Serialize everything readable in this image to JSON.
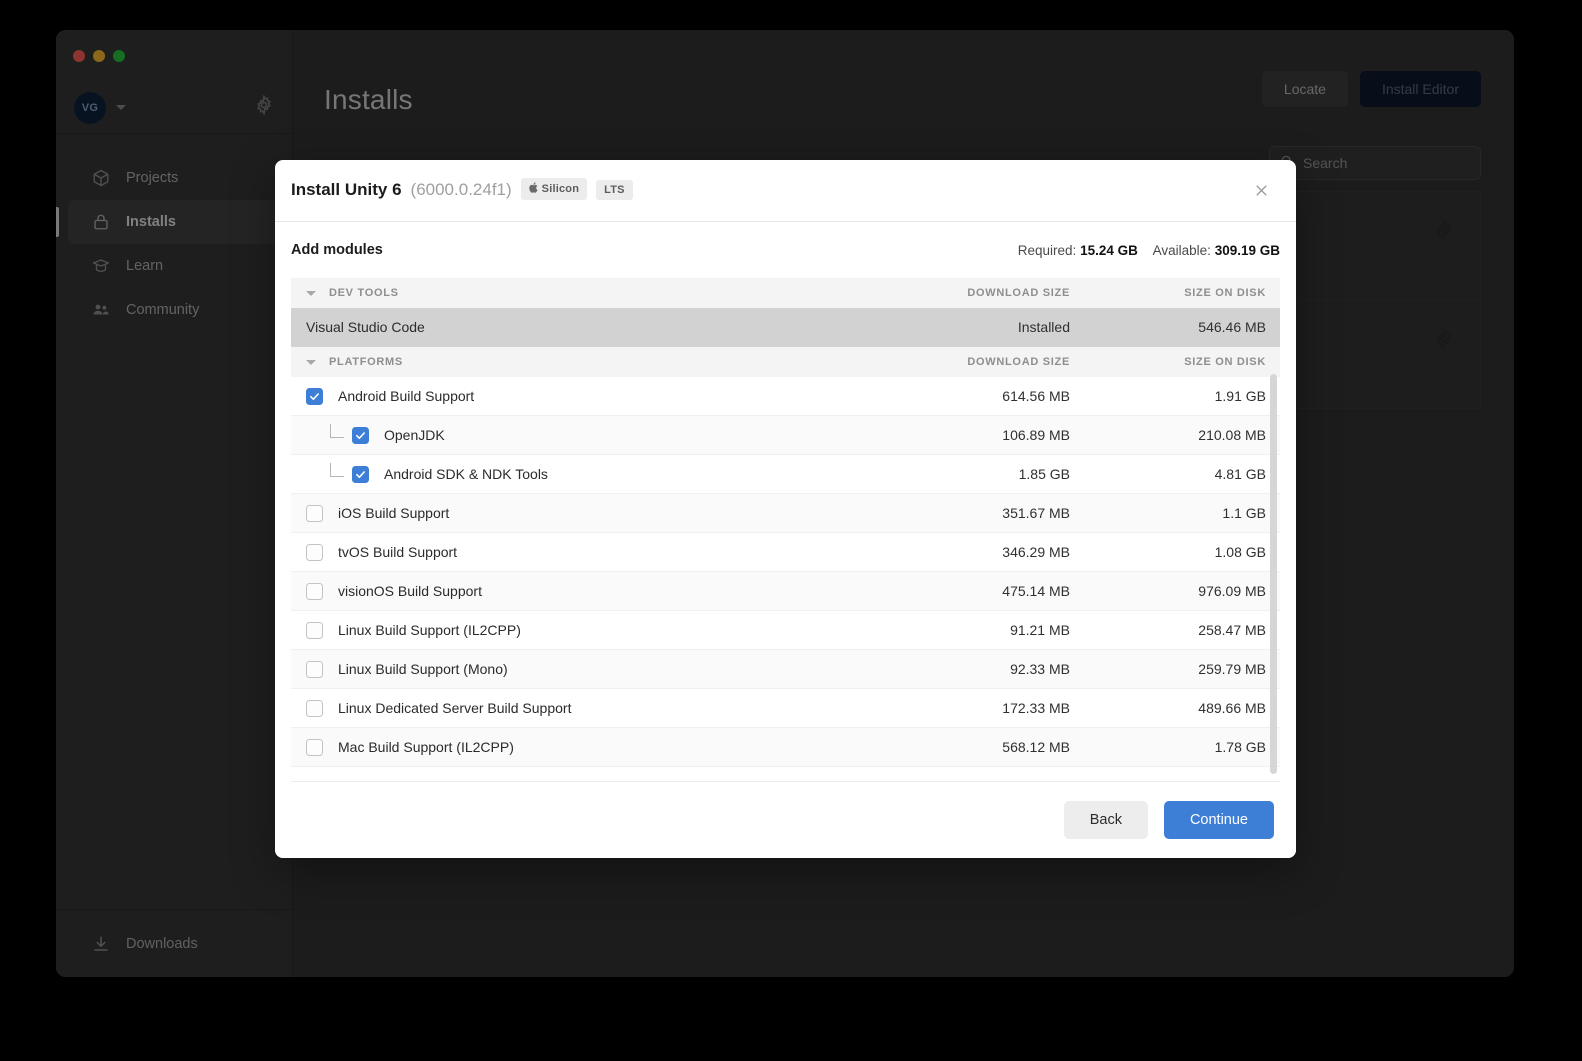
{
  "window": {
    "traffic_lights": [
      "close",
      "minimize",
      "maximize"
    ]
  },
  "sidebar": {
    "account": {
      "initials": "VG"
    },
    "items": [
      {
        "label": "Projects",
        "icon": "cube-icon",
        "active": false
      },
      {
        "label": "Installs",
        "icon": "lock-icon",
        "active": true
      },
      {
        "label": "Learn",
        "icon": "graduation-cap-icon",
        "active": false
      },
      {
        "label": "Community",
        "icon": "people-icon",
        "active": false
      }
    ],
    "downloads": {
      "label": "Downloads",
      "icon": "download-icon"
    }
  },
  "main": {
    "title": "Installs",
    "locate_label": "Locate",
    "install_editor_label": "Install Editor",
    "search_placeholder": "Search",
    "search_value": "",
    "install_cards": [
      {
        "gear": "gear-icon"
      },
      {
        "gear": "gear-icon"
      }
    ]
  },
  "modal": {
    "title": "Install Unity 6",
    "version": "(6000.0.24f1)",
    "chips": [
      {
        "label": "Silicon",
        "icon": "apple-icon"
      },
      {
        "label": "LTS",
        "icon": ""
      }
    ],
    "close_icon": "close-icon",
    "section_label": "Add modules",
    "required_label": "Required:",
    "required_value": "15.24 GB",
    "available_label": "Available:",
    "available_value": "309.19 GB",
    "columns": {
      "download": "DOWNLOAD SIZE",
      "disk": "SIZE ON DISK"
    },
    "groups": [
      {
        "title": "DEV TOOLS",
        "rows": [
          {
            "label": "Visual Studio Code",
            "download": "Installed",
            "disk": "546.46 MB",
            "checkbox": false,
            "checked": false,
            "indent": 0,
            "selected": true
          }
        ]
      },
      {
        "title": "PLATFORMS",
        "rows": [
          {
            "label": "Android Build Support",
            "download": "614.56 MB",
            "disk": "1.91 GB",
            "checkbox": true,
            "checked": true,
            "indent": 0,
            "selected": false
          },
          {
            "label": "OpenJDK",
            "download": "106.89 MB",
            "disk": "210.08 MB",
            "checkbox": true,
            "checked": true,
            "indent": 1,
            "selected": false
          },
          {
            "label": "Android SDK & NDK Tools",
            "download": "1.85 GB",
            "disk": "4.81 GB",
            "checkbox": true,
            "checked": true,
            "indent": 1,
            "selected": false
          },
          {
            "label": "iOS Build Support",
            "download": "351.67 MB",
            "disk": "1.1 GB",
            "checkbox": true,
            "checked": false,
            "indent": 0,
            "selected": false
          },
          {
            "label": "tvOS Build Support",
            "download": "346.29 MB",
            "disk": "1.08 GB",
            "checkbox": true,
            "checked": false,
            "indent": 0,
            "selected": false
          },
          {
            "label": "visionOS Build Support",
            "download": "475.14 MB",
            "disk": "976.09 MB",
            "checkbox": true,
            "checked": false,
            "indent": 0,
            "selected": false
          },
          {
            "label": "Linux Build Support (IL2CPP)",
            "download": "91.21 MB",
            "disk": "258.47 MB",
            "checkbox": true,
            "checked": false,
            "indent": 0,
            "selected": false
          },
          {
            "label": "Linux Build Support (Mono)",
            "download": "92.33 MB",
            "disk": "259.79 MB",
            "checkbox": true,
            "checked": false,
            "indent": 0,
            "selected": false
          },
          {
            "label": "Linux Dedicated Server Build Support",
            "download": "172.33 MB",
            "disk": "489.66 MB",
            "checkbox": true,
            "checked": false,
            "indent": 0,
            "selected": false
          },
          {
            "label": "Mac Build Support (IL2CPP)",
            "download": "568.12 MB",
            "disk": "1.78 GB",
            "checkbox": true,
            "checked": false,
            "indent": 0,
            "selected": false
          }
        ]
      }
    ],
    "back_label": "Back",
    "continue_label": "Continue"
  },
  "colors": {
    "accent": "#3d7fd6",
    "app_bg": "#333333",
    "sidebar_bg": "#383838",
    "modal_bg": "#ffffff",
    "selected_row": "#d2d2d2"
  }
}
